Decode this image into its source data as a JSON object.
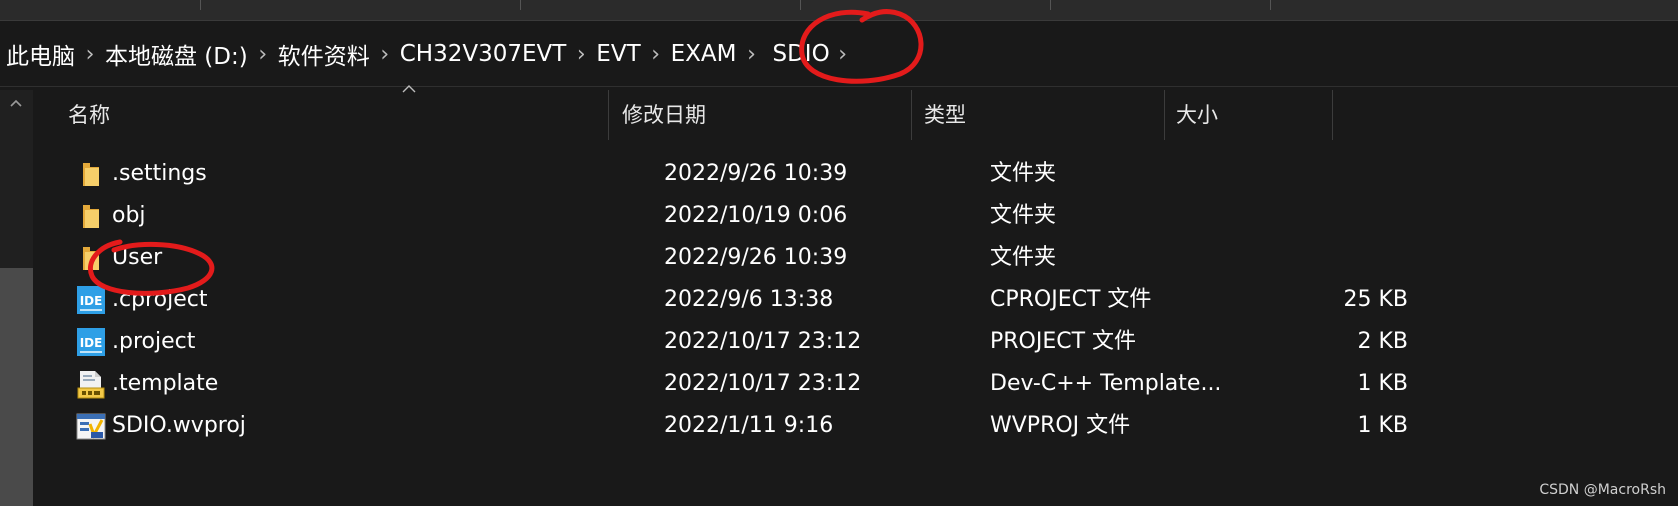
{
  "breadcrumb": {
    "items": [
      "此电脑",
      "本地磁盘 (D:)",
      "软件资料",
      "CH32V307EVT",
      "EVT",
      "EXAM",
      "SDIO"
    ],
    "separator": "›"
  },
  "columns": {
    "name": "名称",
    "date": "修改日期",
    "type": "类型",
    "size": "大小"
  },
  "files": [
    {
      "name": ".settings",
      "date": "2022/9/26 10:39",
      "type": "文件夹",
      "size": "",
      "icon": "folder-icon"
    },
    {
      "name": "obj",
      "date": "2022/10/19 0:06",
      "type": "文件夹",
      "size": "",
      "icon": "folder-icon"
    },
    {
      "name": "User",
      "date": "2022/9/26 10:39",
      "type": "文件夹",
      "size": "",
      "icon": "folder-icon"
    },
    {
      "name": ".cproject",
      "date": "2022/9/6 13:38",
      "type": "CPROJECT 文件",
      "size": "25 KB",
      "icon": "ide-file-icon"
    },
    {
      "name": ".project",
      "date": "2022/10/17 23:12",
      "type": "PROJECT 文件",
      "size": "2 KB",
      "icon": "ide-file-icon"
    },
    {
      "name": ".template",
      "date": "2022/10/17 23:12",
      "type": "Dev-C++ Template...",
      "size": "1 KB",
      "icon": "template-file-icon"
    },
    {
      "name": "SDIO.wvproj",
      "date": "2022/1/11 9:16",
      "type": "WVPROJ 文件",
      "size": "1 KB",
      "icon": "wvproj-file-icon"
    }
  ],
  "icon_glyphs": {
    "ide_label": "IDE"
  },
  "colors": {
    "background": "#191919",
    "folder": "#f4c454",
    "ide_badge": "#2e9fe6",
    "annotation": "#e31b1b"
  },
  "watermark": "CSDN @MacroRsh"
}
